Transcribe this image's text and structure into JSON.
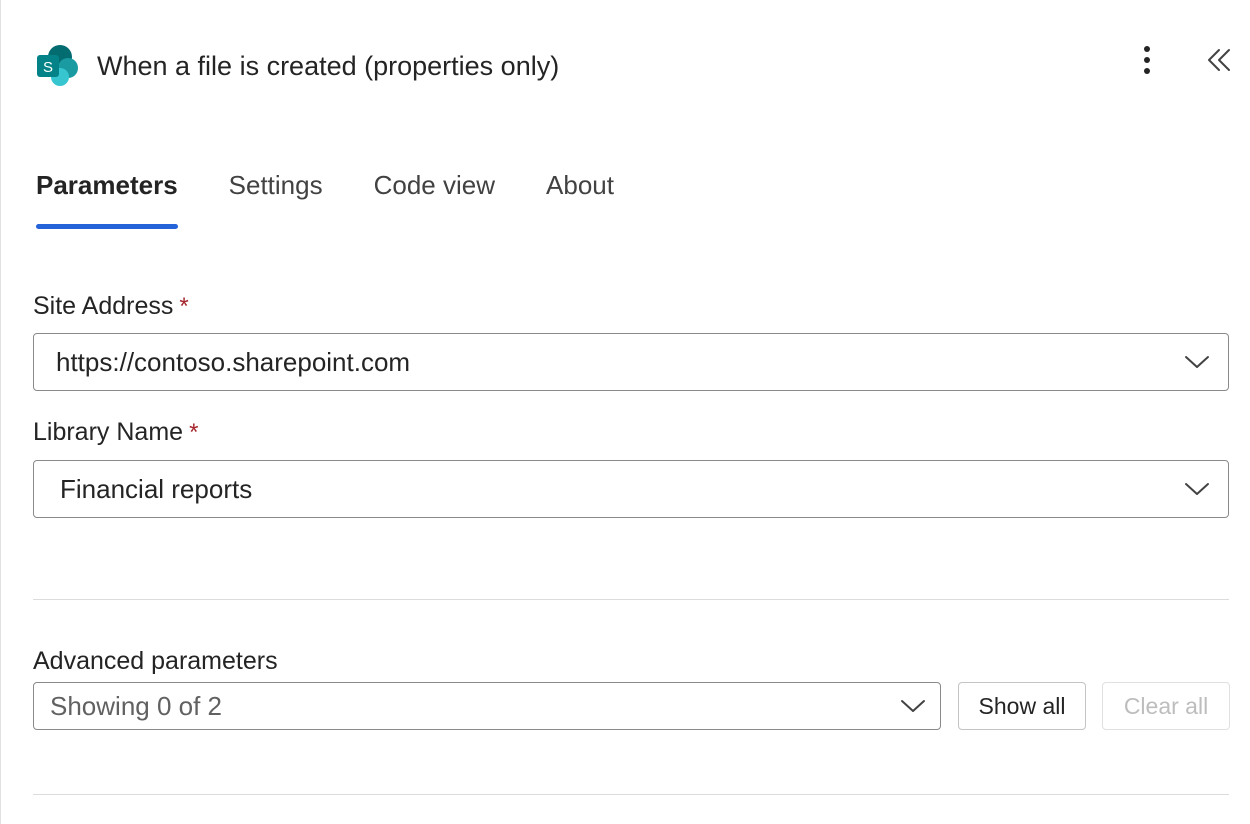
{
  "header": {
    "title": "When a file is created (properties only)",
    "app_icon": "sharepoint-icon",
    "app_icon_letter": "S",
    "more_icon": "more-vertical-icon",
    "collapse_icon": "double-chevron-left-icon"
  },
  "tabs": [
    {
      "label": "Parameters",
      "active": true
    },
    {
      "label": "Settings",
      "active": false
    },
    {
      "label": "Code view",
      "active": false
    },
    {
      "label": "About",
      "active": false
    }
  ],
  "fields": {
    "site_address": {
      "label": "Site Address",
      "required_mark": "*",
      "value": "https://contoso.sharepoint.com"
    },
    "library_name": {
      "label": "Library Name",
      "required_mark": "*",
      "value": "Financial reports"
    }
  },
  "advanced": {
    "label": "Advanced parameters",
    "dropdown_value": "Showing 0 of 2",
    "show_all_label": "Show all",
    "clear_all_label": "Clear all"
  },
  "colors": {
    "accent": "#2563d9",
    "required": "#a4262c",
    "sharepoint_dark": "#036c70",
    "sharepoint_mid": "#1a9ba1",
    "sharepoint_light": "#37c6d0"
  }
}
